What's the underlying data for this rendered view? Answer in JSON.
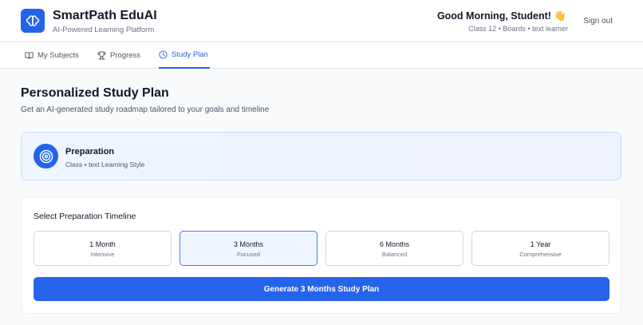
{
  "header": {
    "app_title": "SmartPath EduAI",
    "app_subtitle": "AI-Powered Learning Platform",
    "greeting": "Good Morning, Student! 👋",
    "user_meta": "Class 12 • Boards • text learner",
    "signout_label": "Sign out"
  },
  "tabs": [
    {
      "label": "My Subjects",
      "icon": "book-icon",
      "active": false
    },
    {
      "label": "Progress",
      "icon": "trophy-icon",
      "active": false
    },
    {
      "label": "Study Plan",
      "icon": "clock-icon",
      "active": true
    }
  ],
  "main": {
    "title": "Personalized Study Plan",
    "subtitle": "Get an AI-generated study roadmap tailored to your goals and timeline",
    "prep": {
      "title": "Preparation",
      "subtitle": "Class • text Learning Style",
      "icon": "target-icon"
    },
    "timeline": {
      "title": "Select Preparation Timeline",
      "options": [
        {
          "label": "1 Month",
          "sub": "Intensive",
          "selected": false
        },
        {
          "label": "3 Months",
          "sub": "Focused",
          "selected": true
        },
        {
          "label": "6 Months",
          "sub": "Balanced",
          "selected": false
        },
        {
          "label": "1 Year",
          "sub": "Comprehensive",
          "selected": false
        }
      ],
      "generate_label": "Generate 3 Months Study Plan"
    }
  },
  "colors": {
    "accent": "#2563eb",
    "selected_bg": "#eff6ff",
    "page_bg": "#f8fafc"
  }
}
